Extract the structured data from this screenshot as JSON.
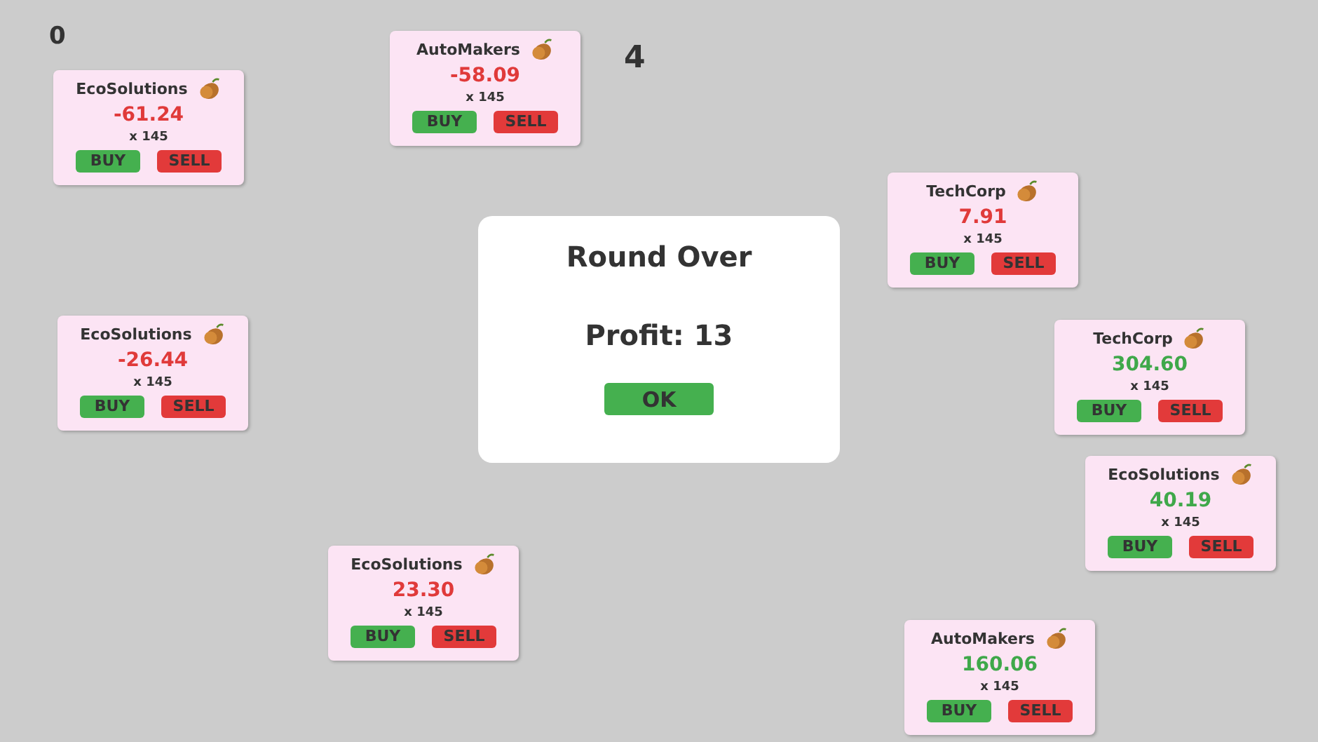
{
  "score": "0",
  "round": "4",
  "stocks": [
    {
      "name": "EcoSolutions",
      "price": "-61.24",
      "color": "#e03a3a",
      "quantity": "x 145",
      "buy": "BUY",
      "sell": "SELL"
    },
    {
      "name": "AutoMakers",
      "price": "-58.09",
      "color": "#e03a3a",
      "quantity": "x 145",
      "buy": "BUY",
      "sell": "SELL"
    },
    {
      "name": "TechCorp",
      "price": "7.91",
      "color": "#e03a3a",
      "quantity": "x 145",
      "buy": "BUY",
      "sell": "SELL"
    },
    {
      "name": "EcoSolutions",
      "price": "-26.44",
      "color": "#e03a3a",
      "quantity": "x 145",
      "buy": "BUY",
      "sell": "SELL"
    },
    {
      "name": "TechCorp",
      "price": "304.60",
      "color": "#3fa84a",
      "quantity": "x 145",
      "buy": "BUY",
      "sell": "SELL"
    },
    {
      "name": "EcoSolutions",
      "price": "40.19",
      "color": "#3fa84a",
      "quantity": "x 145",
      "buy": "BUY",
      "sell": "SELL"
    },
    {
      "name": "EcoSolutions",
      "price": "23.30",
      "color": "#e03a3a",
      "quantity": "x 145",
      "buy": "BUY",
      "sell": "SELL"
    },
    {
      "name": "AutoMakers",
      "price": "160.06",
      "color": "#3fa84a",
      "quantity": "x 145",
      "buy": "BUY",
      "sell": "SELL"
    }
  ],
  "dialog": {
    "title": "Round Over",
    "message": "Profit: 13",
    "button": "OK"
  }
}
